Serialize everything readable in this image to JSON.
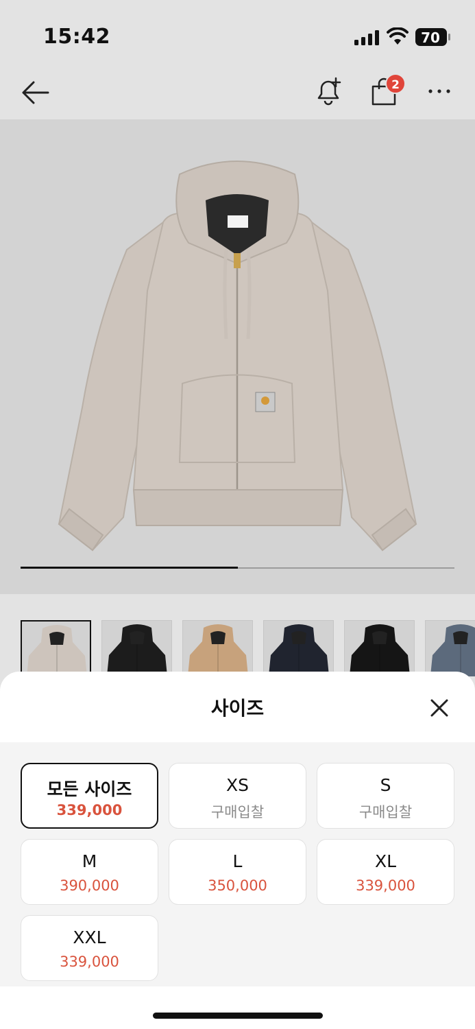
{
  "status": {
    "time": "15:42",
    "battery": "70"
  },
  "nav": {
    "cart_count": "2"
  },
  "gallery": {
    "progress": 0.5
  },
  "sheet": {
    "title": "사이즈",
    "options": [
      {
        "size": "모든 사이즈",
        "price": "339,000",
        "selected": true
      },
      {
        "size": "XS",
        "price": "구매입찰"
      },
      {
        "size": "S",
        "price": "구매입찰"
      },
      {
        "size": "M",
        "price": "390,000"
      },
      {
        "size": "L",
        "price": "350,000"
      },
      {
        "size": "XL",
        "price": "339,000"
      },
      {
        "size": "XXL",
        "price": "339,000"
      }
    ]
  },
  "colors": {
    "accent": "#d9533d",
    "badge": "#e0453a",
    "jacket": "#cdc4bc"
  },
  "thumbnails": [
    {
      "color": "#cdc4bc"
    },
    {
      "color": "#1c1c1c"
    },
    {
      "color": "#c7a27c"
    },
    {
      "color": "#20242f"
    },
    {
      "color": "#151515"
    },
    {
      "color": "#5c6a7c"
    }
  ]
}
